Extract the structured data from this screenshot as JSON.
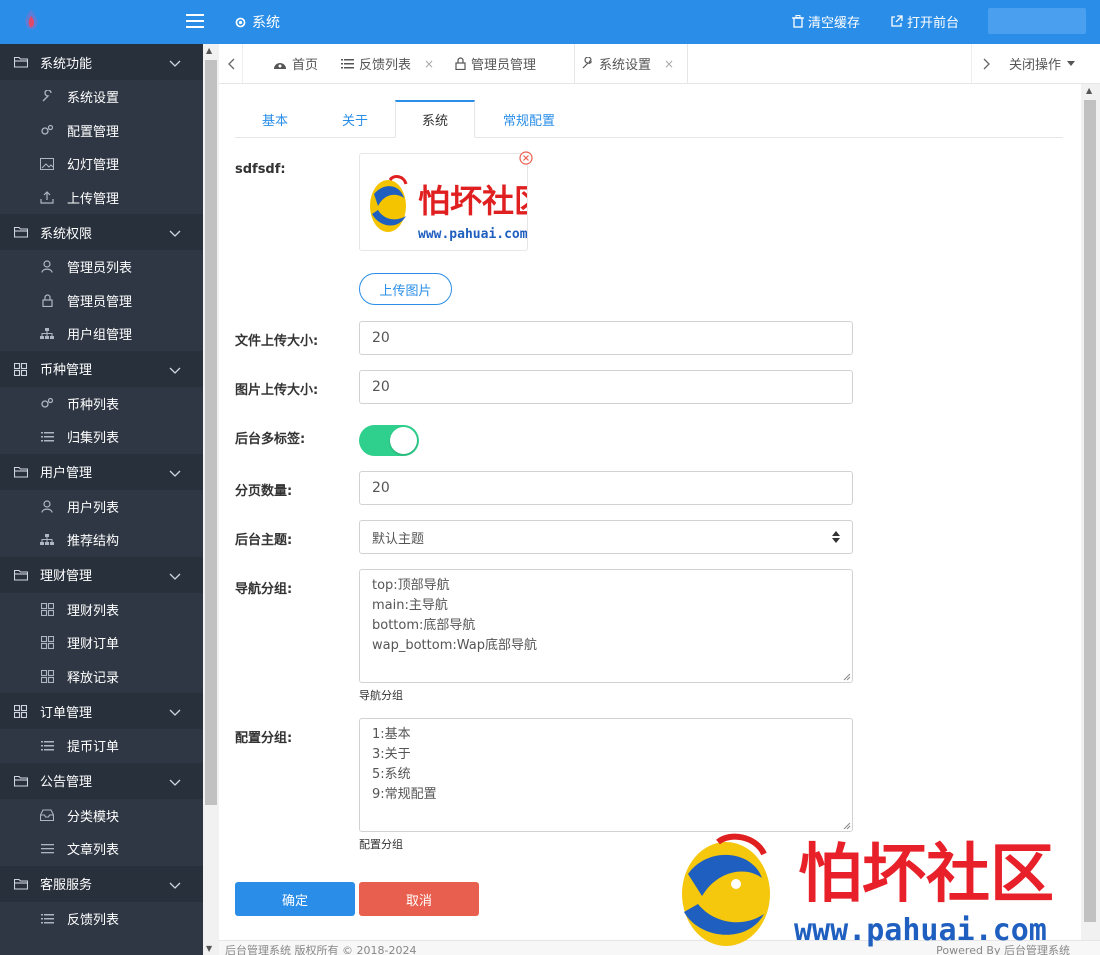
{
  "header": {
    "title": "系统",
    "actions": {
      "clear_cache": "清空缓存",
      "open_front": "打开前台"
    }
  },
  "sidebar": {
    "groups": [
      {
        "label": "系统功能",
        "items": [
          "系统设置",
          "配置管理",
          "幻灯管理",
          "上传管理"
        ]
      },
      {
        "label": "系统权限",
        "items": [
          "管理员列表",
          "管理员管理",
          "用户组管理"
        ]
      },
      {
        "label": "币种管理",
        "items": [
          "币种列表",
          "归集列表"
        ]
      },
      {
        "label": "用户管理",
        "items": [
          "用户列表",
          "推荐结构"
        ]
      },
      {
        "label": "理财管理",
        "items": [
          "理财列表",
          "理财订单",
          "释放记录"
        ]
      },
      {
        "label": "订单管理",
        "items": [
          "提币订单"
        ]
      },
      {
        "label": "公告管理",
        "items": [
          "分类模块",
          "文章列表"
        ]
      },
      {
        "label": "客服服务",
        "items": [
          "反馈列表"
        ]
      }
    ]
  },
  "tabs": {
    "items": [
      {
        "label": "首页"
      },
      {
        "label": "反馈列表"
      },
      {
        "label": "管理员管理"
      },
      {
        "label": "系统设置"
      }
    ],
    "close_x": "×",
    "close_ops": "关闭操作"
  },
  "subtabs": [
    "基本",
    "关于",
    "系统",
    "常规配置"
  ],
  "form": {
    "image_label": "sdfsdf:",
    "upload_btn": "上传图片",
    "file_size_label": "文件上传大小:",
    "file_size_value": "20",
    "image_size_label": "图片上传大小:",
    "image_size_value": "20",
    "multitab_label": "后台多标签:",
    "multitab_on": true,
    "page_count_label": "分页数量:",
    "page_count_value": "20",
    "theme_label": "后台主题:",
    "theme_value": "默认主题",
    "nav_group_label": "导航分组:",
    "nav_group_lines": [
      "top:顶部导航",
      "main:主导航",
      "bottom:底部导航",
      "wap_bottom:Wap底部导航"
    ],
    "nav_group_help": "导航分组",
    "config_group_label": "配置分组:",
    "config_group_lines": [
      "1:基本",
      "3:关于",
      "5:系统",
      "9:常规配置"
    ],
    "config_group_help": "配置分组",
    "ok_btn": "确定",
    "cancel_btn": "取消"
  },
  "footer": {
    "left": "后台管理系统 版权所有 © 2018-2024",
    "right": "Powered By 后台管理系统"
  },
  "watermark": {
    "title": "怕坏社区",
    "url": "www.pahuai.com"
  },
  "colors": {
    "primary": "#2a8ee8",
    "sidebar_bg": "#2f3744",
    "switch_on": "#2fd08d",
    "danger": "#e95f4f"
  }
}
